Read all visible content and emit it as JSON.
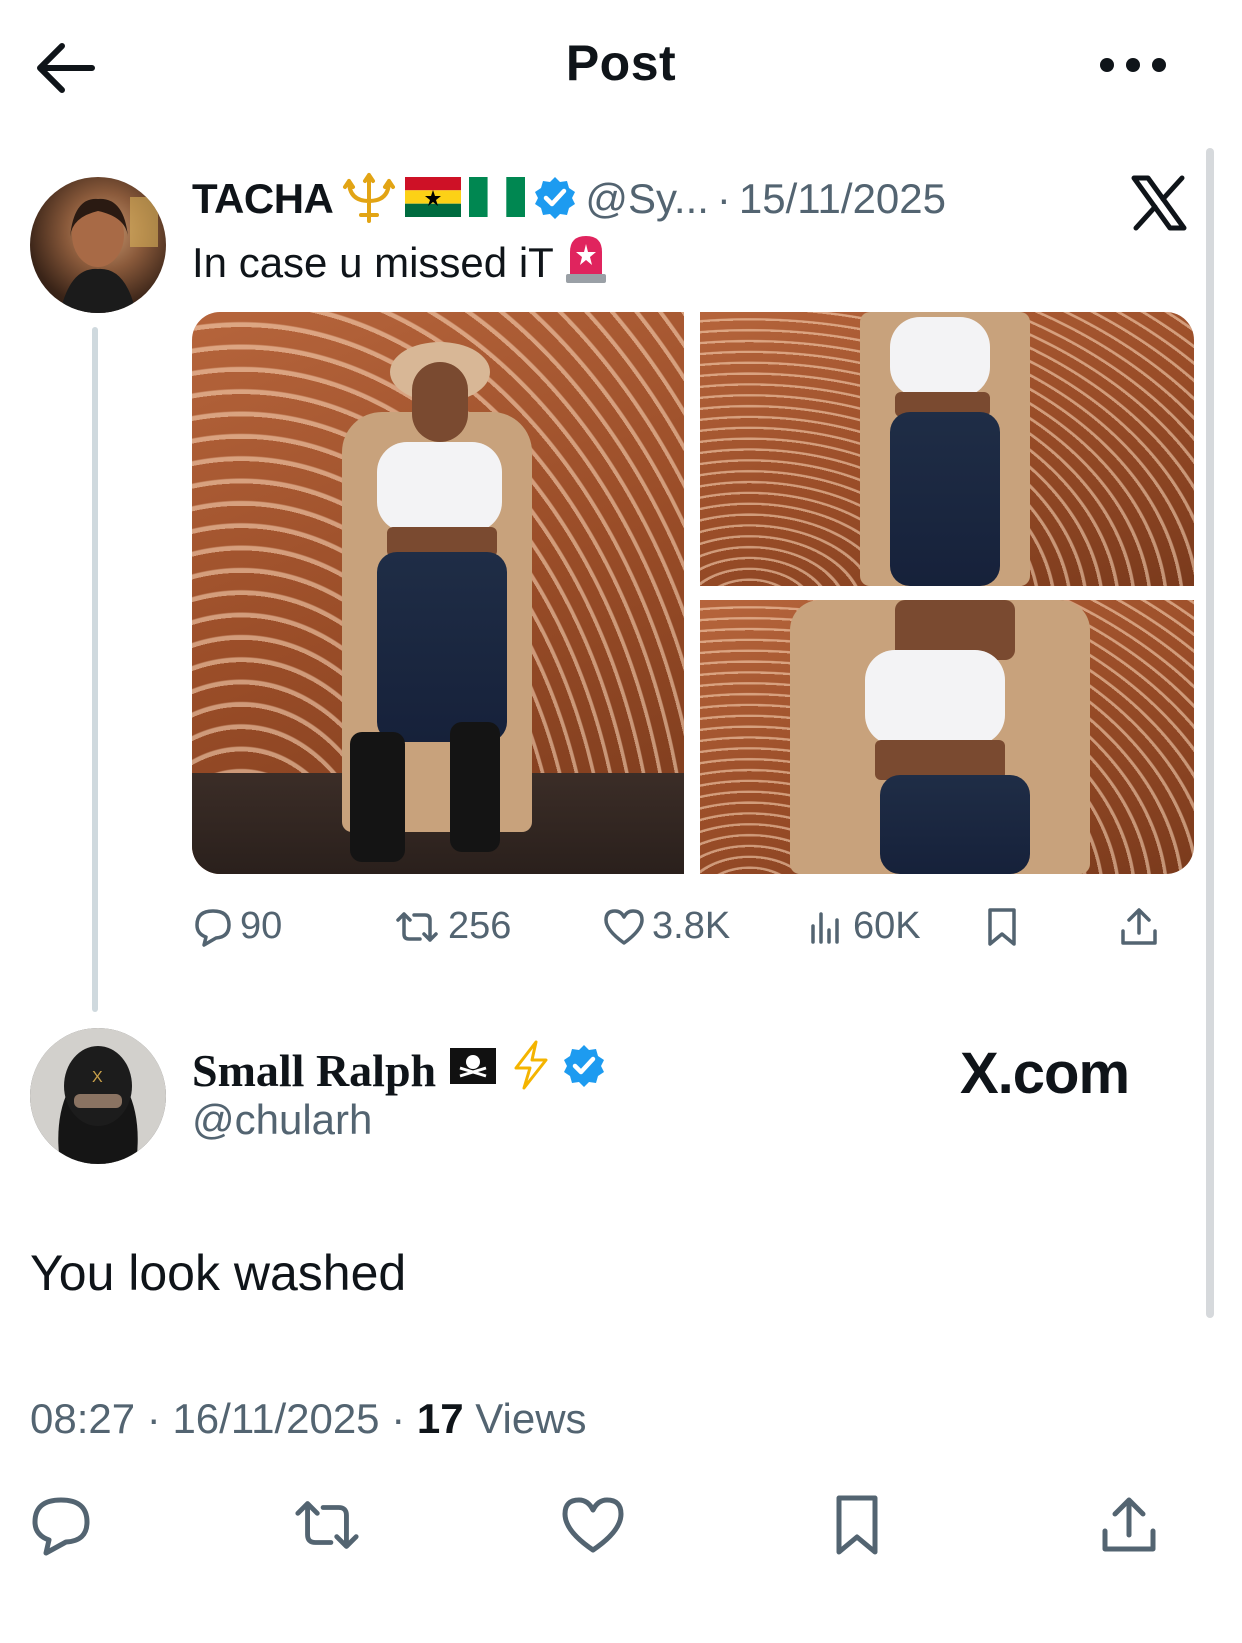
{
  "header": {
    "title": "Post"
  },
  "quoted_post": {
    "author_name": "TACHA",
    "handle_truncated": "@Sy...",
    "separator": "·",
    "date": "15/11/2025",
    "text": "In case u missed iT",
    "stats": {
      "replies": "90",
      "reposts": "256",
      "likes": "3.8K",
      "views": "60K"
    }
  },
  "reply": {
    "author_name": "Small Ralph",
    "handle": "@chularh",
    "brand": "X.com",
    "text": "You look washed",
    "time": "08:27",
    "date": "16/11/2025",
    "separator": "·",
    "views_count": "17",
    "views_label": "Views"
  },
  "colors": {
    "verified": "#1d9bf0",
    "muted_text": "#536471",
    "primary_text": "#0f1419"
  }
}
